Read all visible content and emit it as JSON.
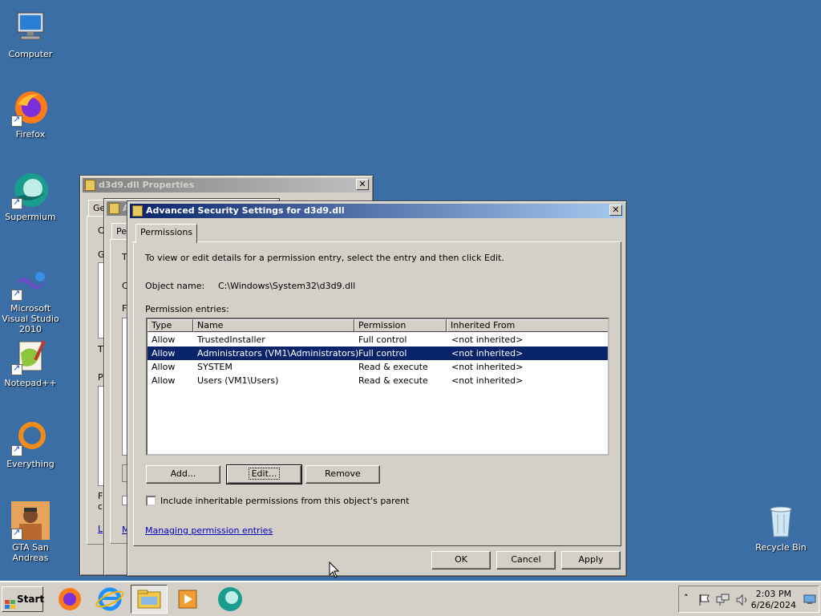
{
  "desktop": {
    "icons": [
      {
        "label": "Computer"
      },
      {
        "label": "Firefox"
      },
      {
        "label": "Supermium"
      },
      {
        "label": "Microsoft Visual Studio 2010"
      },
      {
        "label": "Notepad++"
      },
      {
        "label": "Everything"
      },
      {
        "label": "GTA San Andreas"
      },
      {
        "label": "Recycle Bin"
      }
    ]
  },
  "props_window": {
    "title": "d3d9.dll Properties",
    "tab_partial": "Ge",
    "side_letters": [
      "C",
      "G",
      "C",
      "F",
      "T",
      "P",
      "F",
      "c",
      "L",
      "M"
    ]
  },
  "middle_window": {
    "title_partial": "A",
    "tab_partial": "Pe",
    "side_letters": [
      "T",
      "C",
      "F"
    ]
  },
  "adv_window": {
    "title": "Advanced Security Settings for d3d9.dll",
    "close_glyph": "✕",
    "tab": "Permissions",
    "instruction": "To view or edit details for a permission entry, select the entry and then click Edit.",
    "object_name_label": "Object name:",
    "object_name_value": "C:\\Windows\\System32\\d3d9.dll",
    "entries_label": "Permission entries:",
    "columns": [
      "Type",
      "Name",
      "Permission",
      "Inherited From"
    ],
    "rows": [
      {
        "type": "Allow",
        "name": "TrustedInstaller",
        "permission": "Full control",
        "inherited": "<not inherited>",
        "selected": false
      },
      {
        "type": "Allow",
        "name": "Administrators (VM1\\Administrators)",
        "permission": "Full control",
        "inherited": "<not inherited>",
        "selected": true
      },
      {
        "type": "Allow",
        "name": "SYSTEM",
        "permission": "Read & execute",
        "inherited": "<not inherited>",
        "selected": false
      },
      {
        "type": "Allow",
        "name": "Users (VM1\\Users)",
        "permission": "Read & execute",
        "inherited": "<not inherited>",
        "selected": false
      }
    ],
    "buttons": {
      "add": "Add...",
      "edit": "Edit...",
      "remove": "Remove"
    },
    "include_checkbox": {
      "label": "Include inheritable permissions from this object's parent",
      "checked": false
    },
    "link": "Managing permission entries",
    "footer": {
      "ok": "OK",
      "cancel": "Cancel",
      "apply": "Apply"
    }
  },
  "taskbar": {
    "start": "Start",
    "pinned": [
      "firefox-icon",
      "internet-explorer-icon",
      "file-explorer-icon",
      "media-player-icon",
      "supermium-icon"
    ],
    "tray_icons": [
      "show-hidden-icons-chevron",
      "action-center-flag-icon",
      "network-icon",
      "volume-icon"
    ],
    "chevron_glyph": "˄",
    "time": "2:03 PM",
    "date": "6/26/2024"
  },
  "colors": {
    "desktop": "#3a6ea5",
    "selection": "#0a246a",
    "title_active_start": "#0a246a",
    "window_face": "#d4d0c8"
  }
}
